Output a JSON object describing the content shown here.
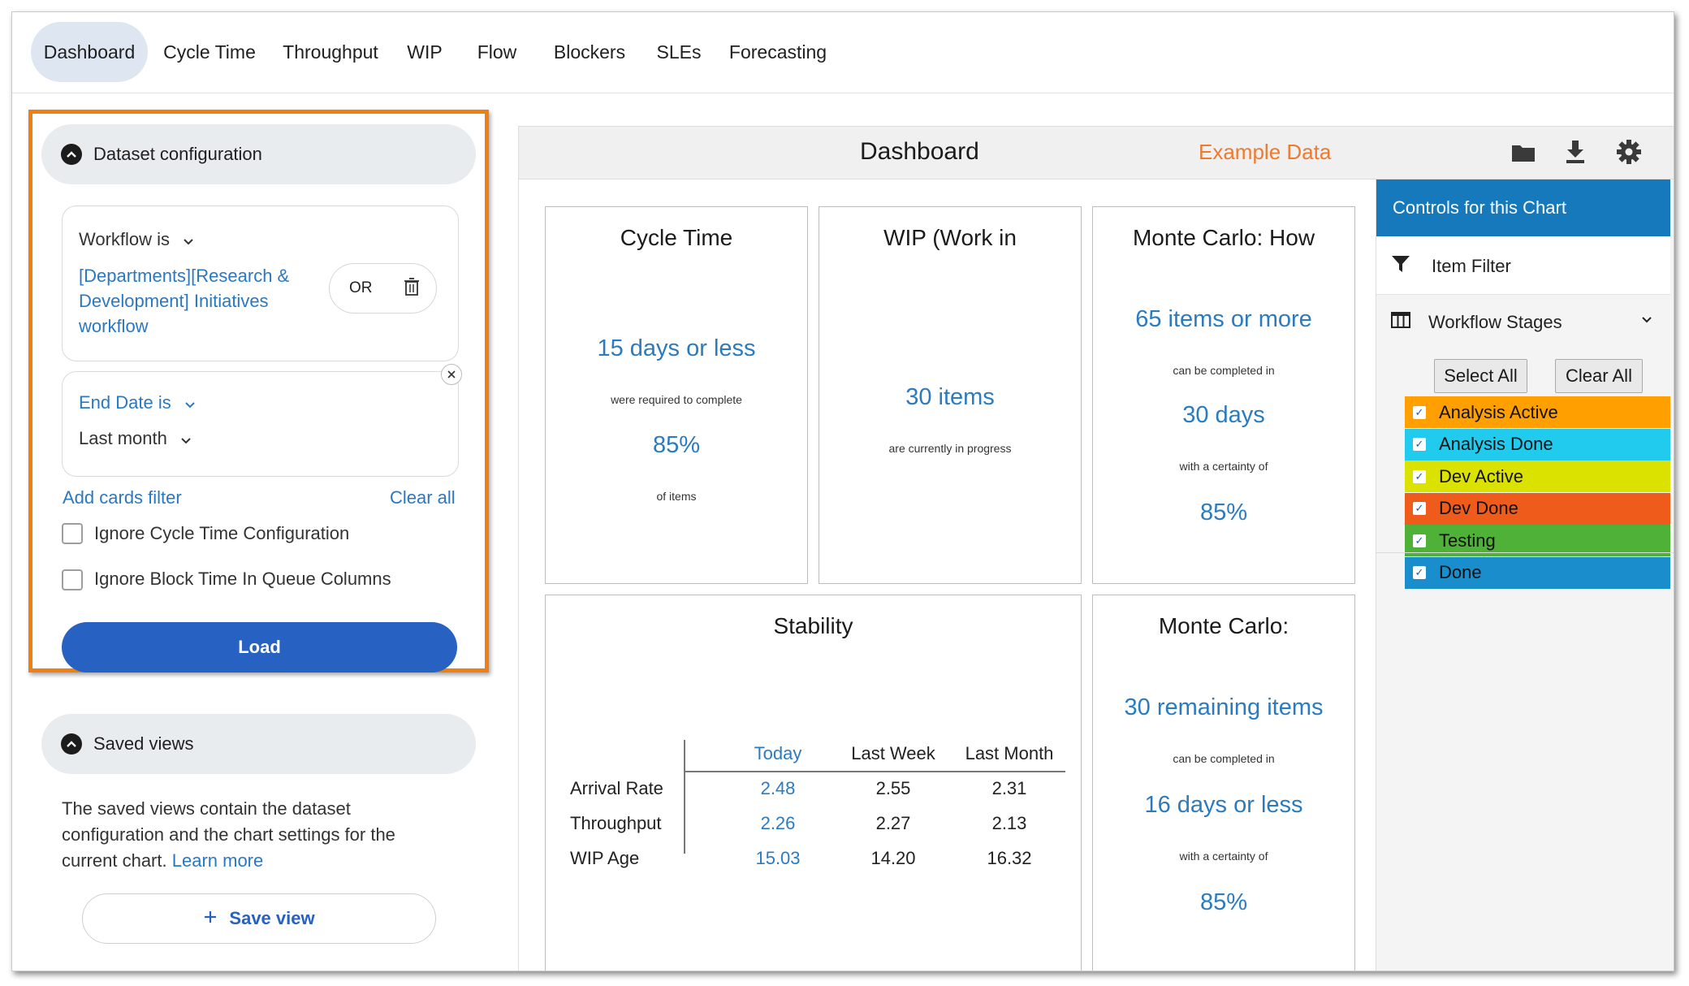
{
  "nav": {
    "tabs": [
      {
        "label": "Dashboard",
        "active": true
      },
      {
        "label": "Cycle Time"
      },
      {
        "label": "Throughput"
      },
      {
        "label": "WIP"
      },
      {
        "label": "Flow"
      },
      {
        "label": "Blockers"
      },
      {
        "label": "SLEs"
      },
      {
        "label": "Forecasting"
      }
    ]
  },
  "config": {
    "header": "Dataset configuration",
    "workflow_label": "Workflow is",
    "workflow_value_1": "[Departments][Research &",
    "workflow_value_2": "Development] Initiatives",
    "workflow_value_3": "workflow",
    "or_label": "OR",
    "end_date_label": "End Date is",
    "end_date_value": "Last month",
    "add_filter": "Add cards filter",
    "clear_all": "Clear all",
    "ignore_cycle": "Ignore Cycle Time Configuration",
    "ignore_block": "Ignore Block Time In Queue Columns",
    "load": "Load"
  },
  "saved": {
    "header": "Saved views",
    "desc_1": "The saved views contain the dataset",
    "desc_2": "configuration and the chart settings for the",
    "desc_3": "current chart.",
    "learn_more": "Learn more",
    "save_view": "Save view"
  },
  "dashboard": {
    "title": "Dashboard",
    "example": "Example Data",
    "icons": [
      "folder-icon",
      "download-icon",
      "gear-icon"
    ],
    "colors": {
      "accent": "#2a7bbf",
      "example": "#ee7a2f",
      "highlight": "#f07f13"
    }
  },
  "tiles": {
    "cycle": {
      "title": "Cycle Time",
      "value": "15 days or less",
      "sub1": "were required to complete",
      "pct": "85%",
      "sub2": "of items"
    },
    "wip": {
      "title": "WIP (Work in",
      "value": "30 items",
      "sub": "are currently in progress"
    },
    "mc_how": {
      "title": "Monte Carlo: How",
      "value": "65 items or more",
      "sub1": "can be completed in",
      "days": "30 days",
      "sub2": "with a certainty of",
      "pct": "85%"
    },
    "stability": {
      "title": "Stability",
      "columns": [
        "Today",
        "Last Week",
        "Last Month"
      ],
      "rows": [
        {
          "label": "Arrival Rate",
          "today": "2.48",
          "week": "2.55",
          "month": "2.31"
        },
        {
          "label": "Throughput",
          "today": "2.26",
          "week": "2.27",
          "month": "2.13"
        },
        {
          "label": "WIP Age",
          "today": "15.03",
          "week": "14.20",
          "month": "16.32"
        }
      ]
    },
    "mc_when": {
      "title": "Monte Carlo:",
      "value": "30 remaining items",
      "sub1": "can be completed in",
      "days": "16 days or less",
      "sub2": "with a certainty of",
      "pct": "85%"
    }
  },
  "controls": {
    "header": "Controls for this Chart",
    "item_filter": "Item Filter",
    "workflow_stages": "Workflow Stages",
    "select_all": "Select All",
    "clear_all": "Clear All",
    "stages": [
      {
        "label": "Analysis Active",
        "color": "#ffa000"
      },
      {
        "label": "Analysis Done",
        "color": "#21cbee"
      },
      {
        "label": "Dev Active",
        "color": "#dce200"
      },
      {
        "label": "Dev Done",
        "color": "#ef5b1b"
      },
      {
        "label": "Testing",
        "color": "#4fb137"
      },
      {
        "label": "Done",
        "color": "#1a8dcc"
      }
    ]
  }
}
